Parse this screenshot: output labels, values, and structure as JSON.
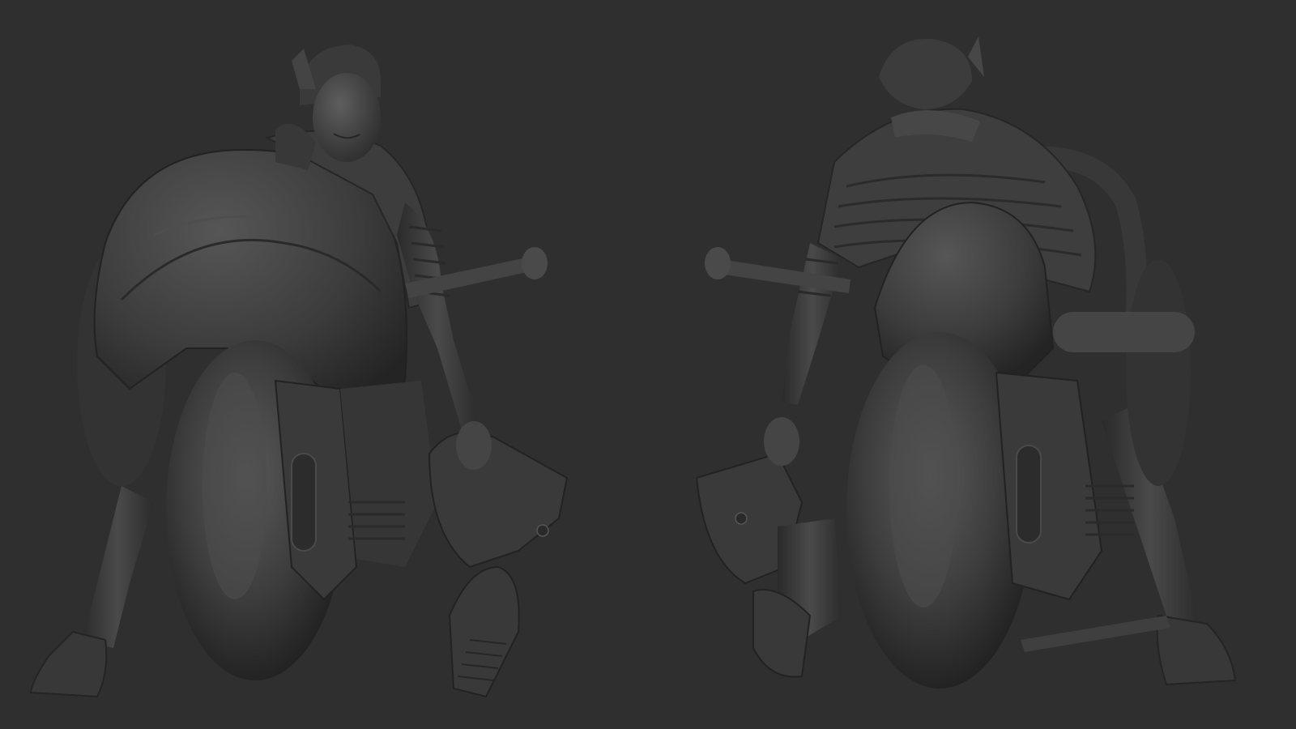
{
  "scene": {
    "background_color": "#2f2f2f",
    "sculpt_color": "#3f3f3f",
    "highlight_color": "#5a5a5a",
    "shadow_color": "#1f1f1f",
    "views": [
      {
        "name": "front-three-quarter-view",
        "subject": "rider-on-motorcycle"
      },
      {
        "name": "rear-three-quarter-view",
        "subject": "rider-on-motorcycle"
      }
    ]
  }
}
